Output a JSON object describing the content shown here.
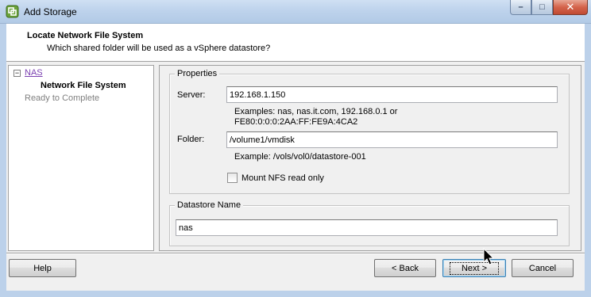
{
  "window": {
    "title": "Add Storage",
    "controls": {
      "minimize": "–",
      "maximize": "□",
      "close": "✕"
    }
  },
  "header": {
    "title": "Locate Network File System",
    "subtitle": "Which shared folder will be used as a vSphere datastore?"
  },
  "steps": {
    "toggle": "−",
    "items": [
      {
        "label": "NAS",
        "state": "visited-link"
      },
      {
        "label": "Network File System",
        "state": "current"
      },
      {
        "label": "Ready to Complete",
        "state": "pending"
      }
    ]
  },
  "properties": {
    "legend": "Properties",
    "server_label": "Server:",
    "server_value": "192.168.1.150",
    "server_hint_line1": "Examples: nas, nas.it.com, 192.168.0.1 or",
    "server_hint_line2": "FE80:0:0:0:2AA:FF:FE9A:4CA2",
    "folder_label": "Folder:",
    "folder_value": "/volume1/vmdisk",
    "folder_hint": "Example: /vols/vol0/datastore-001",
    "mount_readonly_label": "Mount NFS read only",
    "mount_readonly_checked": false
  },
  "datastore": {
    "legend": "Datastore Name",
    "value": "nas"
  },
  "buttons": {
    "help": "Help",
    "back": "< Back",
    "next": "Next >",
    "cancel": "Cancel"
  },
  "colors": {
    "titlebar": "#bed3ec",
    "visited_link": "#7a3fb0",
    "pending_step": "#7f7f7f",
    "dialog_bg": "#f0f0f0",
    "default_button_border": "#3c7fb1"
  }
}
